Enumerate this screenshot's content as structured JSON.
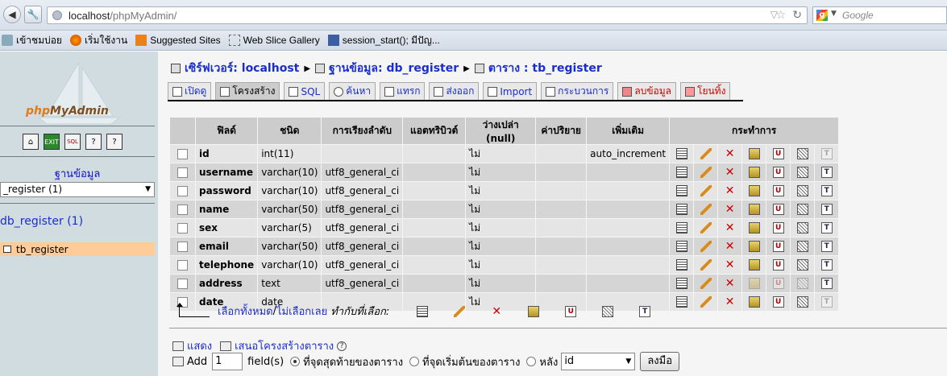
{
  "browser": {
    "url_host": "localhost",
    "url_path": "/phpMyAdmin/",
    "search_placeholder": "Google",
    "bookmarks": [
      {
        "label": "เข้าชมบ่อย"
      },
      {
        "label": "เริ่มใช้งาน"
      },
      {
        "label": "Suggested Sites"
      },
      {
        "label": "Web Slice Gallery"
      },
      {
        "label": "session_start(); มีปัญ..."
      }
    ]
  },
  "sidebar": {
    "logo_php": "php",
    "logo_my": "MyAdmin",
    "icons": [
      "home-icon",
      "exit-icon",
      "sql-icon",
      "query-window-icon",
      "docs-icon"
    ],
    "database_label": "ฐานข้อมูล",
    "database_select": "_register (1)",
    "db_title": "db_register (1)",
    "table_item": "tb_register"
  },
  "breadcrumb": {
    "server": "เซิร์ฟเวอร์: localhost",
    "database": "ฐานข้อมูล: db_register",
    "table": "ตาราง : tb_register"
  },
  "tabs": [
    {
      "label": "เปิดดู"
    },
    {
      "label": "โครงสร้าง"
    },
    {
      "label": "SQL"
    },
    {
      "label": "ค้นหา"
    },
    {
      "label": "แทรก"
    },
    {
      "label": "ส่งออก"
    },
    {
      "label": "Import"
    },
    {
      "label": "กระบวนการ"
    },
    {
      "label": "ลบข้อมูล"
    },
    {
      "label": "โยนทิ้ง"
    }
  ],
  "table": {
    "headers": [
      "ฟิลด์",
      "ชนิด",
      "การเรียงลำดับ",
      "แอตทริบิวต์",
      "ว่างเปล่า (null)",
      "ค่าปริยาย",
      "เพิ่มเติม",
      "กระทำการ"
    ],
    "rows": [
      {
        "field": "id",
        "type": "int(11)",
        "collation": "",
        "attributes": "",
        "null": "ไม่",
        "default": "",
        "extra": "auto_increment"
      },
      {
        "field": "username",
        "type": "varchar(10)",
        "collation": "utf8_general_ci",
        "attributes": "",
        "null": "ไม่",
        "default": "",
        "extra": ""
      },
      {
        "field": "password",
        "type": "varchar(10)",
        "collation": "utf8_general_ci",
        "attributes": "",
        "null": "ไม่",
        "default": "",
        "extra": ""
      },
      {
        "field": "name",
        "type": "varchar(50)",
        "collation": "utf8_general_ci",
        "attributes": "",
        "null": "ไม่",
        "default": "",
        "extra": ""
      },
      {
        "field": "sex",
        "type": "varchar(5)",
        "collation": "utf8_general_ci",
        "attributes": "",
        "null": "ไม่",
        "default": "",
        "extra": ""
      },
      {
        "field": "email",
        "type": "varchar(50)",
        "collation": "utf8_general_ci",
        "attributes": "",
        "null": "ไม่",
        "default": "",
        "extra": ""
      },
      {
        "field": "telephone",
        "type": "varchar(10)",
        "collation": "utf8_general_ci",
        "attributes": "",
        "null": "ไม่",
        "default": "",
        "extra": ""
      },
      {
        "field": "address",
        "type": "text",
        "collation": "utf8_general_ci",
        "attributes": "",
        "null": "ไม่",
        "default": "",
        "extra": ""
      },
      {
        "field": "date",
        "type": "date",
        "collation": "",
        "attributes": "",
        "null": "ไม่",
        "default": "",
        "extra": ""
      }
    ]
  },
  "selection": {
    "check_all": "เลือกทั้งหมด",
    "separator": " / ",
    "uncheck_all": "ไม่เลือกเลย",
    "with_selected": "ทำกับที่เลือก:"
  },
  "footer": {
    "print_view": "แสดง",
    "propose_structure": "เสนอโครงสร้างตาราง",
    "add_label": "Add",
    "add_count": "1",
    "fields_label": "field(s)",
    "at_end": "ที่จุดสุดท้ายของตาราง",
    "at_beginning": "ที่จุดเริ่มต้นของตาราง",
    "after": "หลัง",
    "after_field": "id",
    "go": "ลงมือ"
  }
}
